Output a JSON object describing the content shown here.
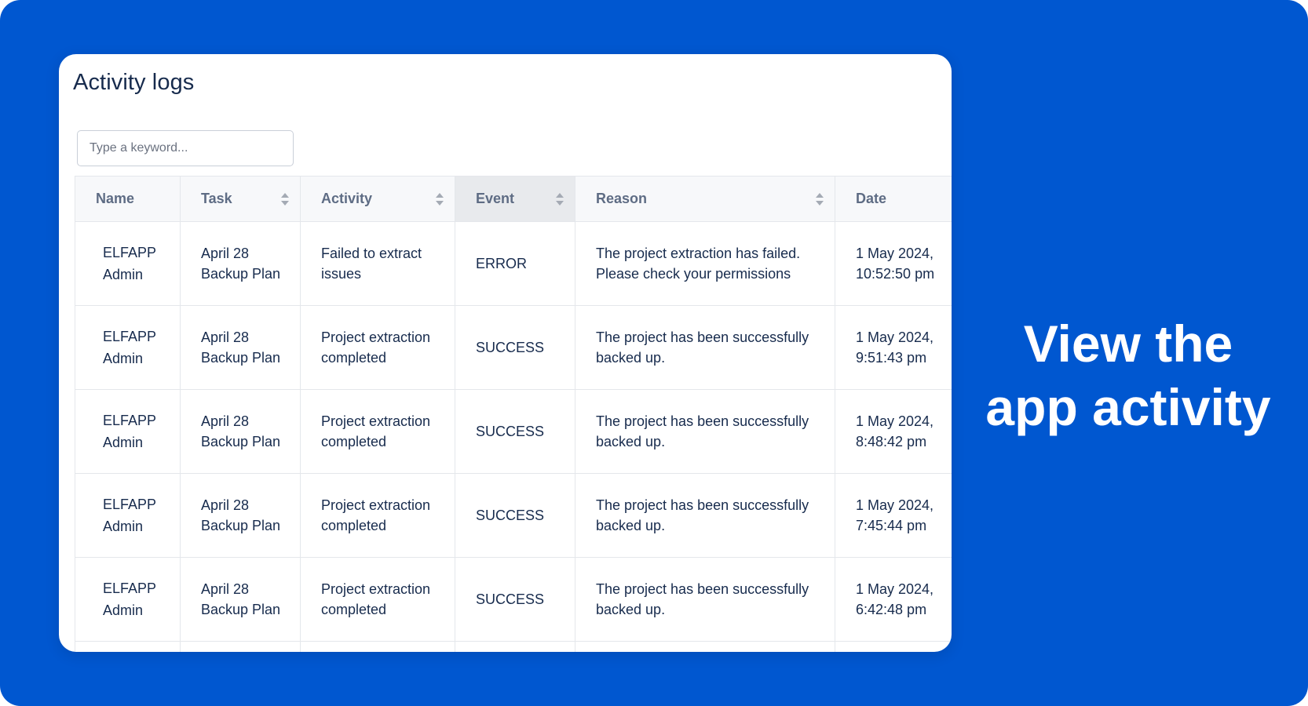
{
  "card": {
    "title": "Activity logs"
  },
  "search": {
    "placeholder": "Type a keyword...",
    "value": ""
  },
  "table": {
    "columns": [
      "Name",
      "Task",
      "Activity",
      "Event",
      "Reason",
      "Date"
    ],
    "sortable": [
      false,
      true,
      true,
      true,
      true,
      true
    ],
    "active_sort_column": "Event",
    "rows": [
      {
        "name": "ELFAPP Admin",
        "task": "April 28 Backup Plan",
        "activity": "Failed to extract issues",
        "event": "ERROR",
        "reason": "The project extraction has failed. Please check your permissions",
        "date": "1 May 2024, 10:52:50 pm"
      },
      {
        "name": "ELFAPP Admin",
        "task": "April 28 Backup Plan",
        "activity": "Project extraction completed",
        "event": "SUCCESS",
        "reason": "The project has been successfully backed up.",
        "date": "1 May 2024, 9:51:43 pm"
      },
      {
        "name": "ELFAPP Admin",
        "task": "April 28 Backup Plan",
        "activity": "Project extraction completed",
        "event": "SUCCESS",
        "reason": "The project has been successfully backed up.",
        "date": "1 May 2024, 8:48:42 pm"
      },
      {
        "name": "ELFAPP Admin",
        "task": "April 28 Backup Plan",
        "activity": "Project extraction completed",
        "event": "SUCCESS",
        "reason": "The project has been successfully backed up.",
        "date": "1 May 2024, 7:45:44 pm"
      },
      {
        "name": "ELFAPP Admin",
        "task": "April 28 Backup Plan",
        "activity": "Project extraction completed",
        "event": "SUCCESS",
        "reason": "The project has been successfully backed up.",
        "date": "1 May 2024, 6:42:48 pm"
      }
    ]
  },
  "tagline": {
    "line1": "View the",
    "line2": "app activity"
  },
  "colors": {
    "banner_background": "#0057d0",
    "card_background": "#ffffff",
    "title_text": "#172b4d",
    "header_text": "#5e6c84",
    "active_header_background": "#e8eaed",
    "tagline_text": "#ffffff"
  }
}
